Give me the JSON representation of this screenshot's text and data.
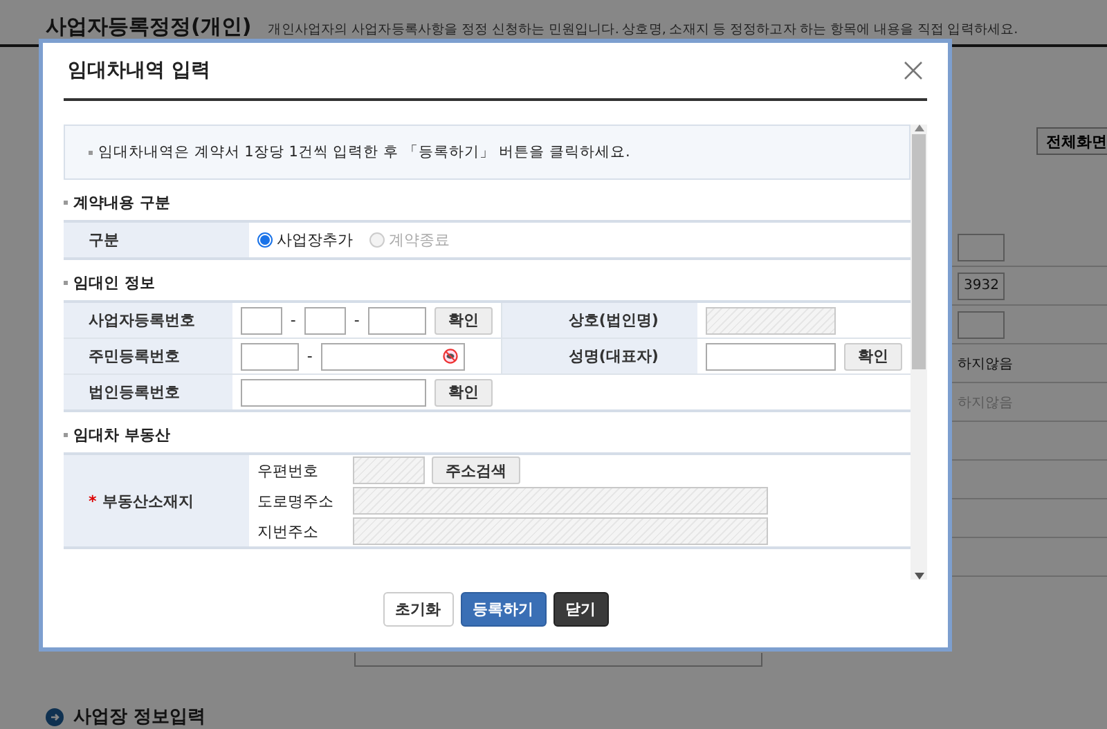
{
  "background": {
    "title": "사업자등록정정(개인)",
    "description": "개인사업자의 사업자등록사항을 정정 신청하는 민원입니다. 상호명, 소재지 등 정정하고자 하는 항목에 내용을 직접 입력하세요.",
    "fullscreen_button": "전체화면",
    "field_value": "3932",
    "options": [
      {
        "text": "하지않음",
        "disabled": false
      },
      {
        "text": "하지않음",
        "disabled": true
      }
    ],
    "section_heading": "사업장 정보입력"
  },
  "dialog": {
    "title": "임대차내역 입력",
    "notice": "임대차내역은 계약서 1장당 1건씩 입력한 후 「등록하기」 버튼을 클릭하세요.",
    "sections": [
      {
        "heading": "계약내용 구분",
        "kind": "radio",
        "rows": [
          {
            "label": "구분",
            "options": [
              {
                "text": "사업장추가",
                "selected": true,
                "disabled": false
              },
              {
                "text": "계약종료",
                "selected": false,
                "disabled": true
              }
            ]
          }
        ]
      },
      {
        "heading": "임대인 정보",
        "kind": "grid",
        "rows": [
          {
            "cells": [
              {
                "label": "사업자등록번호",
                "controls": [
                  {
                    "kind": "short"
                  },
                  {
                    "kind": "dash",
                    "text": "-"
                  },
                  {
                    "kind": "short"
                  },
                  {
                    "kind": "dash",
                    "text": "-"
                  },
                  {
                    "kind": "medium"
                  },
                  {
                    "kind": "button",
                    "text": "확인"
                  }
                ]
              },
              {
                "label": "상호(법인명)",
                "controls": [
                  {
                    "kind": "readonly"
                  }
                ]
              }
            ]
          },
          {
            "cells": [
              {
                "label": "주민등록번호",
                "controls": [
                  {
                    "kind": "medium"
                  },
                  {
                    "kind": "dash",
                    "text": "-"
                  },
                  {
                    "kind": "masked"
                  }
                ]
              },
              {
                "label": "성명(대표자)",
                "controls": [
                  {
                    "kind": "field"
                  },
                  {
                    "kind": "button",
                    "text": "확인"
                  }
                ]
              }
            ]
          },
          {
            "cells": [
              {
                "label": "법인등록번호",
                "controls": [
                  {
                    "kind": "long"
                  },
                  {
                    "kind": "button",
                    "text": "확인"
                  }
                ]
              }
            ]
          }
        ]
      },
      {
        "heading": "임대차 부동산",
        "kind": "address",
        "rows": [
          {
            "label": "부동산소재지",
            "required_mark": "*",
            "lines": [
              {
                "label": "우편번호",
                "controls": [
                  {
                    "kind": "readonly-short"
                  },
                  {
                    "kind": "button",
                    "text": "주소검색"
                  }
                ]
              },
              {
                "label": "도로명주소",
                "controls": [
                  {
                    "kind": "readonly-wide"
                  }
                ]
              },
              {
                "label": "지번주소",
                "controls": [
                  {
                    "kind": "readonly-wide"
                  }
                ]
              }
            ]
          }
        ]
      }
    ],
    "buttons": [
      {
        "label": "초기화",
        "kind": "reset"
      },
      {
        "label": "등록하기",
        "kind": "primary"
      },
      {
        "label": "닫기",
        "kind": "dark"
      }
    ]
  }
}
